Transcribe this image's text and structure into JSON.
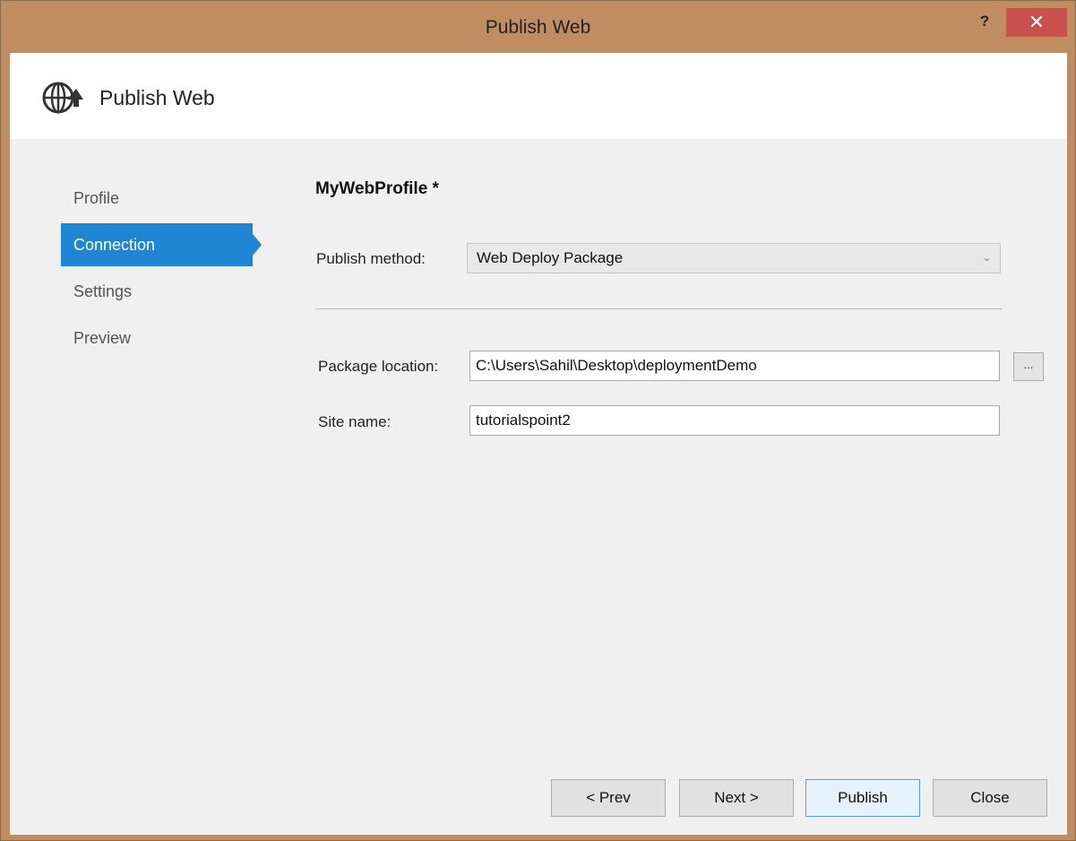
{
  "window": {
    "title": "Publish Web",
    "help_label": "?",
    "close_label": "✕"
  },
  "header": {
    "title": "Publish Web",
    "icon": "globe-publish-icon"
  },
  "nav": {
    "items": [
      {
        "label": "Profile",
        "active": false
      },
      {
        "label": "Connection",
        "active": true
      },
      {
        "label": "Settings",
        "active": false
      },
      {
        "label": "Preview",
        "active": false
      }
    ]
  },
  "main": {
    "profile_name": "MyWebProfile *",
    "publish_method_label": "Publish method:",
    "publish_method_value": "Web Deploy Package",
    "package_location_label": "Package location:",
    "package_location_value": "C:\\Users\\Sahil\\Desktop\\deploymentDemo",
    "browse_label": "...",
    "site_name_label": "Site name:",
    "site_name_value": "tutorialspoint2"
  },
  "footer": {
    "prev_label": "< Prev",
    "next_label": "Next >",
    "publish_label": "Publish",
    "close_label": "Close"
  },
  "colors": {
    "titlebar": "#c08d60",
    "close_button": "#c9504c",
    "nav_active": "#1e86d4",
    "body_background": "#f0f0f0"
  }
}
